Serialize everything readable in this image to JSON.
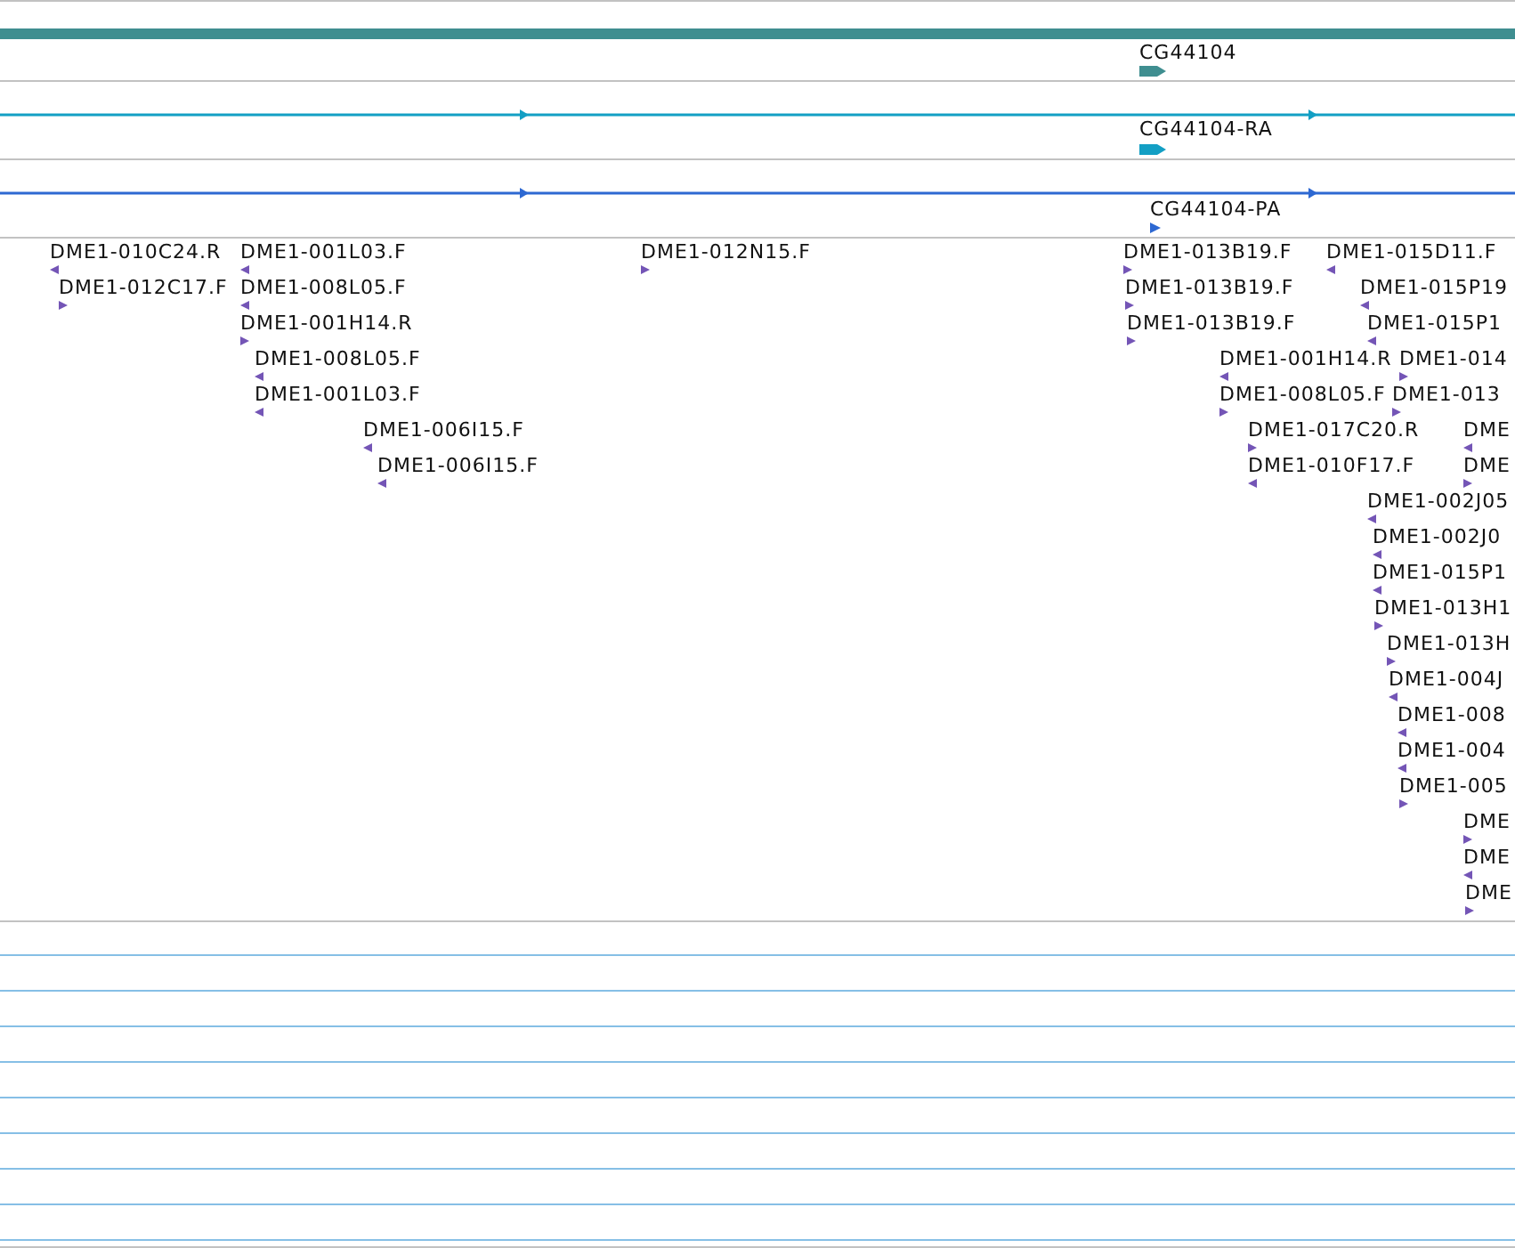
{
  "tracks": [
    {
      "kind": "gene",
      "features": [
        {
          "kind": "span"
        },
        {
          "kind": "block",
          "label": "CG44104",
          "forward": true
        }
      ]
    },
    {
      "kind": "transcript",
      "features": [
        {
          "kind": "line",
          "forward": true
        },
        {
          "kind": "block",
          "label": "CG44104-RA",
          "forward": true
        }
      ]
    },
    {
      "kind": "protein",
      "features": [
        {
          "kind": "line",
          "forward": true
        },
        {
          "kind": "marker",
          "label": "CG44104-PA",
          "forward": true
        }
      ]
    },
    {
      "kind": "clones",
      "features": [
        {
          "kind": "marker",
          "label": "DME1-010C24.R",
          "forward": false
        },
        {
          "kind": "marker",
          "label": "DME1-001L03.F",
          "forward": false
        },
        {
          "kind": "marker",
          "label": "DME1-012N15.F",
          "forward": true
        },
        {
          "kind": "marker",
          "label": "DME1-013B19.F",
          "forward": true
        },
        {
          "kind": "marker",
          "label": "DME1-015D11.F",
          "forward": false
        },
        {
          "kind": "marker",
          "label": "DME1-012C17.F",
          "forward": true
        },
        {
          "kind": "marker",
          "label": "DME1-008L05.F",
          "forward": false
        },
        {
          "kind": "marker",
          "label": "DME1-013B19.F",
          "forward": true
        },
        {
          "kind": "marker",
          "label": "DME1-015P19",
          "forward": false
        },
        {
          "kind": "marker",
          "label": "DME1-001H14.R",
          "forward": true
        },
        {
          "kind": "marker",
          "label": "DME1-013B19.F",
          "forward": true
        },
        {
          "kind": "marker",
          "label": "DME1-015P1",
          "forward": false
        },
        {
          "kind": "marker",
          "label": "DME1-008L05.F",
          "forward": false
        },
        {
          "kind": "marker",
          "label": "DME1-001H14.R",
          "forward": false
        },
        {
          "kind": "marker",
          "label": "DME1-014",
          "forward": true
        },
        {
          "kind": "marker",
          "label": "DME1-001L03.F",
          "forward": false
        },
        {
          "kind": "marker",
          "label": "DME1-008L05.F",
          "forward": true
        },
        {
          "kind": "marker",
          "label": "DME1-013",
          "forward": true
        },
        {
          "kind": "marker",
          "label": "DME1-006I15.F",
          "forward": false
        },
        {
          "kind": "marker",
          "label": "DME1-017C20.R",
          "forward": true
        },
        {
          "kind": "marker",
          "label": "DME",
          "forward": false
        },
        {
          "kind": "marker",
          "label": "DME1-006I15.F",
          "forward": false
        },
        {
          "kind": "marker",
          "label": "DME1-010F17.F",
          "forward": false
        },
        {
          "kind": "marker",
          "label": "DME",
          "forward": true
        },
        {
          "kind": "marker",
          "label": "DME1-002J05",
          "forward": false
        },
        {
          "kind": "marker",
          "label": "DME1-002J0",
          "forward": false
        },
        {
          "kind": "marker",
          "label": "DME1-015P1",
          "forward": false
        },
        {
          "kind": "marker",
          "label": "DME1-013H1",
          "forward": true
        },
        {
          "kind": "marker",
          "label": "DME1-013H",
          "forward": true
        },
        {
          "kind": "marker",
          "label": "DME1-004J",
          "forward": false
        },
        {
          "kind": "marker",
          "label": "DME1-008",
          "forward": false
        },
        {
          "kind": "marker",
          "label": "DME1-004",
          "forward": false
        },
        {
          "kind": "marker",
          "label": "DME1-005",
          "forward": true
        },
        {
          "kind": "marker",
          "label": "DME",
          "forward": true
        },
        {
          "kind": "marker",
          "label": "DME",
          "forward": false
        },
        {
          "kind": "marker",
          "label": "DME",
          "forward": true
        }
      ]
    }
  ]
}
